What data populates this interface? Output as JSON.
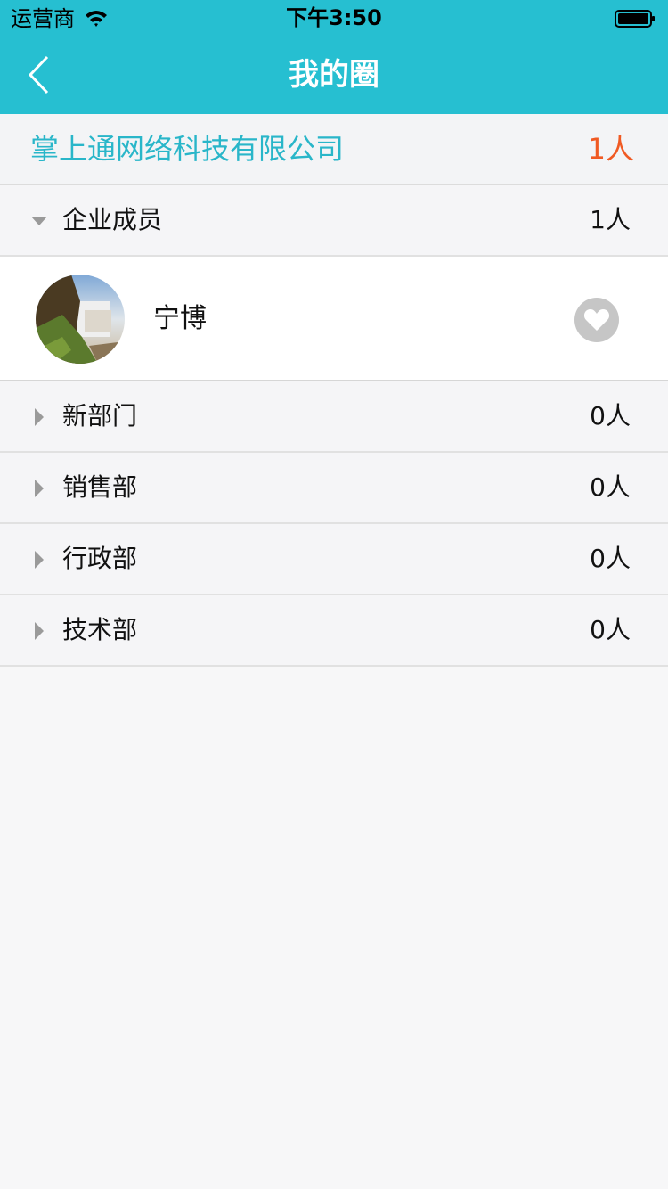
{
  "status_bar": {
    "carrier": "运营商",
    "time": "下午3:50"
  },
  "nav": {
    "title": "我的圈",
    "back_icon": "chevron-left-icon"
  },
  "company": {
    "name": "掌上通网络科技有限公司",
    "count": "1人"
  },
  "groups": [
    {
      "label": "企业成员",
      "count": "1人",
      "expanded": true
    },
    {
      "label": "新部门",
      "count": "0人",
      "expanded": false
    },
    {
      "label": "销售部",
      "count": "0人",
      "expanded": false
    },
    {
      "label": "行政部",
      "count": "0人",
      "expanded": false
    },
    {
      "label": "技术部",
      "count": "0人",
      "expanded": false
    }
  ],
  "members": [
    {
      "name": "宁博",
      "action_icon": "heart-icon"
    }
  ],
  "colors": {
    "header": "#26bfd1",
    "company_name": "#29b6c9",
    "company_count": "#f05a23",
    "background": "#f7f7f8"
  }
}
